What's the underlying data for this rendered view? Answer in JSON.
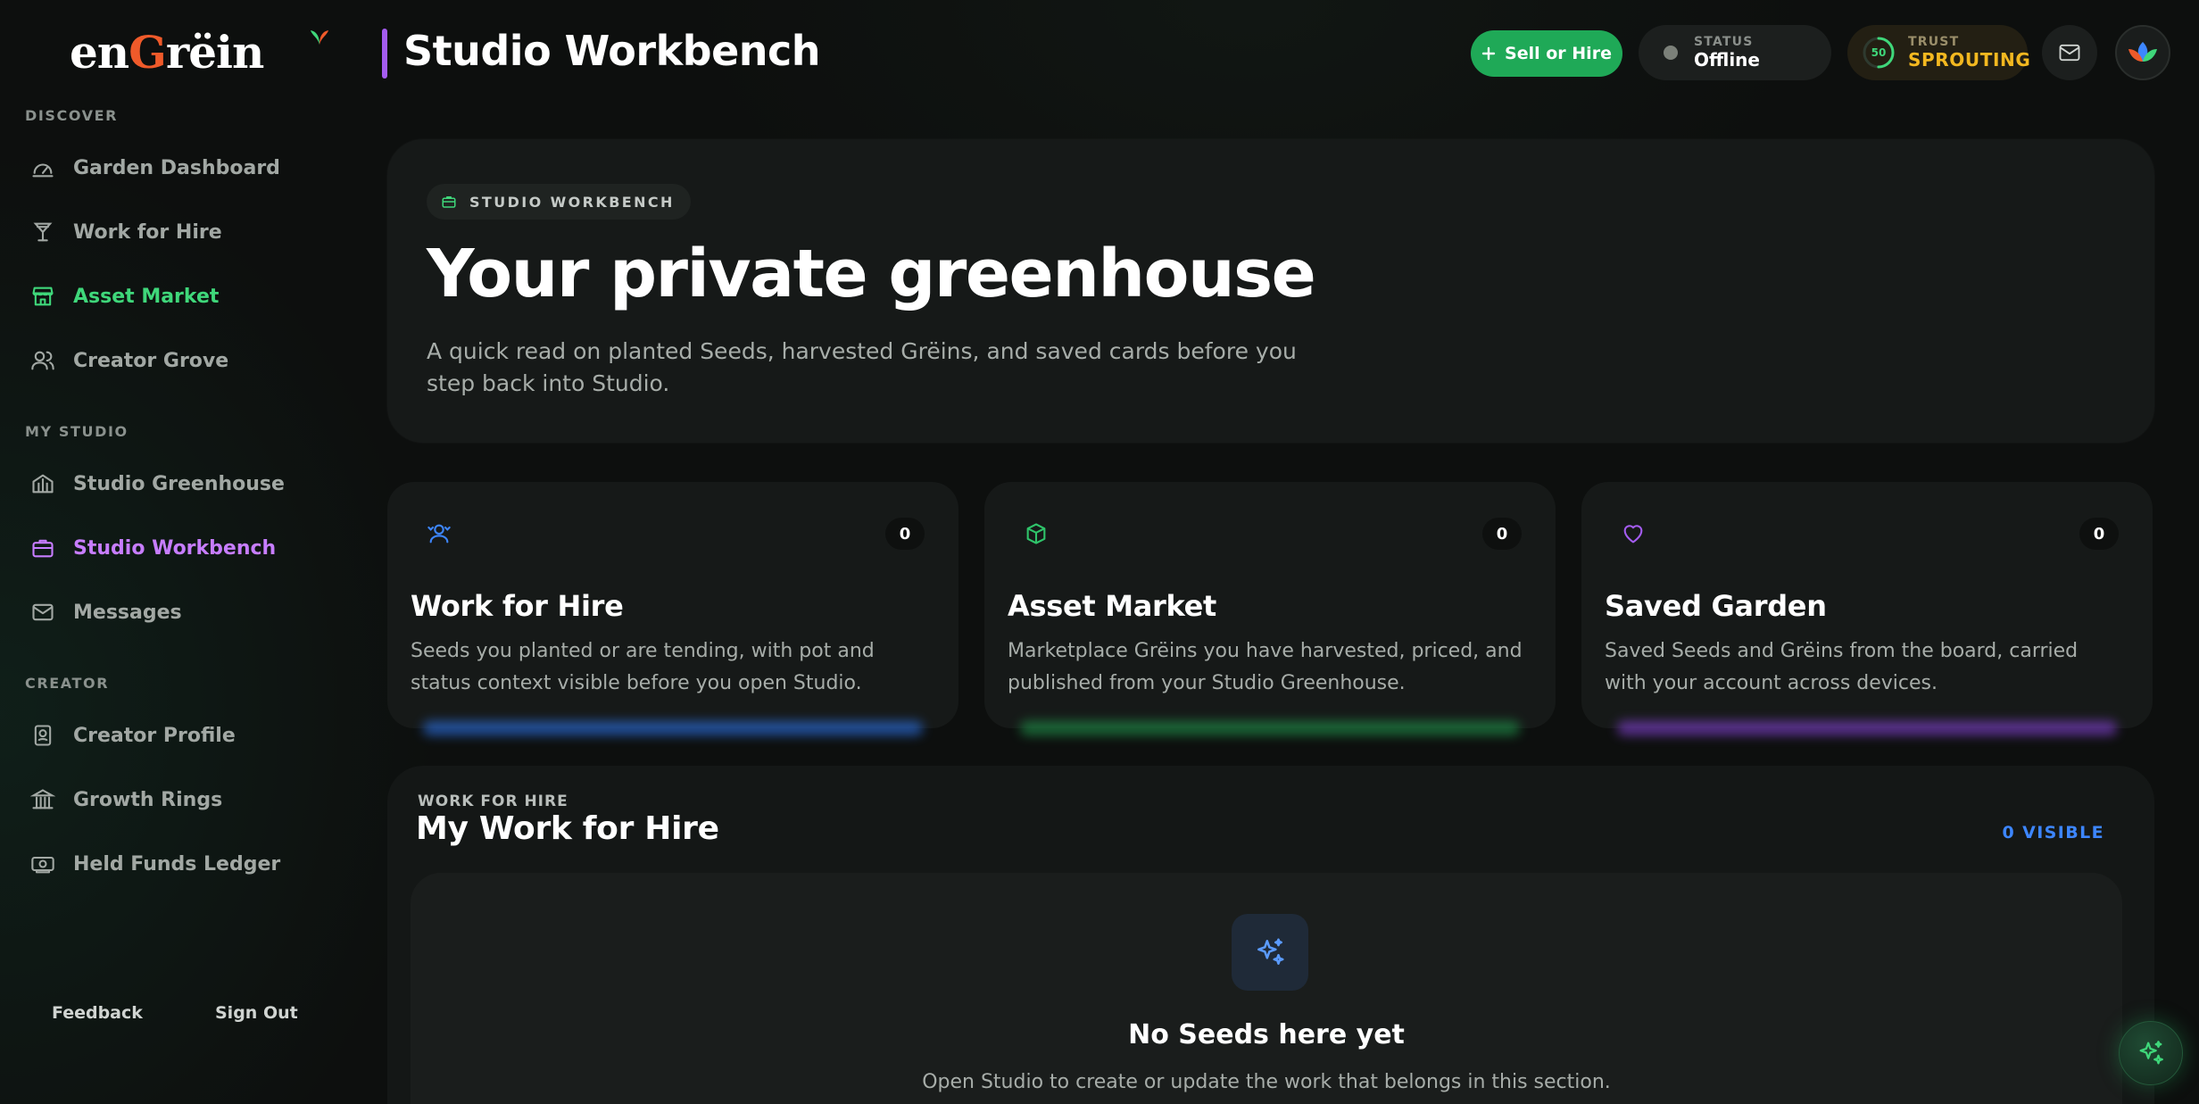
{
  "brand": {
    "logo_pre": "en",
    "logo_g": "G",
    "logo_post": "rëin"
  },
  "sidebar": {
    "sections": [
      {
        "label": "DISCOVER"
      },
      {
        "label": "MY STUDIO"
      },
      {
        "label": "CREATOR"
      }
    ],
    "items": [
      {
        "label": "Garden Dashboard",
        "icon": "gauge-icon"
      },
      {
        "label": "Work for Hire",
        "icon": "martini-icon"
      },
      {
        "label": "Asset Market",
        "icon": "store-icon",
        "active": true
      },
      {
        "label": "Creator Grove",
        "icon": "users-icon"
      },
      {
        "label": "Studio Greenhouse",
        "icon": "greenhouse-icon"
      },
      {
        "label": "Studio Workbench",
        "icon": "briefcase-icon",
        "active": true
      },
      {
        "label": "Messages",
        "icon": "mail-icon"
      },
      {
        "label": "Creator Profile",
        "icon": "id-badge-icon"
      },
      {
        "label": "Growth Rings",
        "icon": "bank-icon"
      },
      {
        "label": "Held Funds Ledger",
        "icon": "banknote-icon"
      }
    ],
    "footer": {
      "feedback": "Feedback",
      "sign_out": "Sign Out"
    }
  },
  "header": {
    "title": "Studio Workbench",
    "sell_button": "Sell or Hire",
    "status_label": "STATUS",
    "status_value": "Offline",
    "trust_label": "TRUST",
    "trust_value": "SPROUTING",
    "trust_score": "50",
    "trust_progress": 0.5
  },
  "hero": {
    "chip": "STUDIO WORKBENCH",
    "title": "Your private greenhouse",
    "subtitle": "A quick read on planted Seeds, harvested Grëins, and saved cards before you step back into Studio."
  },
  "cards": [
    {
      "title": "Work for Hire",
      "count": "0",
      "description": "Seeds you planted or are tending, with pot and status context visible before you open Studio.",
      "icon": "user-sync-icon",
      "accent": "#3d86ff"
    },
    {
      "title": "Asset Market",
      "count": "0",
      "description": "Marketplace Grëins you have harvested, priced, and published from your Studio Greenhouse.",
      "icon": "cube-icon",
      "accent": "#2fc46a"
    },
    {
      "title": "Saved Garden",
      "count": "0",
      "description": "Saved Seeds and Grëins from the board, carried with your account across devices.",
      "icon": "heart-icon",
      "accent": "#a45cf0"
    }
  ],
  "section": {
    "eyebrow": "WORK FOR HIRE",
    "title": "My Work for Hire",
    "visible_count": "0 VISIBLE",
    "empty_title": "No Seeds here yet",
    "empty_subtitle": "Open Studio to create or update the work that belongs in this section."
  },
  "colors": {
    "background": "#0d0f0e",
    "green": "#3fd77a",
    "purple": "#c77dff",
    "sell_button": "#1fa957",
    "trust_gold": "#f3b820",
    "blue": "#3d86ff"
  }
}
